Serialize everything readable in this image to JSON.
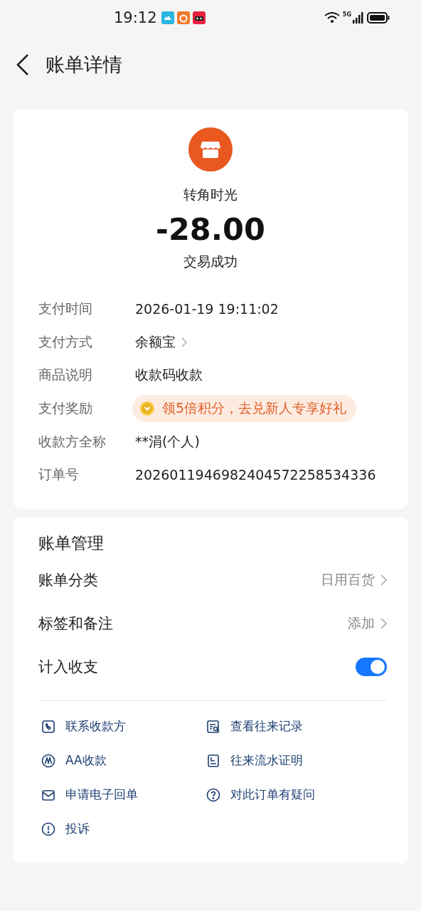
{
  "status_bar": {
    "time": "19:12",
    "network": "5G"
  },
  "header": {
    "title": "账单详情"
  },
  "summary": {
    "merchant": "转角时光",
    "amount": "-28.00",
    "status": "交易成功"
  },
  "details": [
    {
      "label": "支付时间",
      "value": "2026-01-19 19:11:02",
      "kind": "text"
    },
    {
      "label": "支付方式",
      "value": "余额宝",
      "kind": "link"
    },
    {
      "label": "商品说明",
      "value": "收款码收款",
      "kind": "text"
    },
    {
      "label": "支付奖励",
      "value": "领5倍积分，去兑新人专享好礼",
      "kind": "reward"
    },
    {
      "label": "收款方全称",
      "value": "**涓(个人)",
      "kind": "text"
    },
    {
      "label": "订单号",
      "value": "2026011946982404572258534336",
      "kind": "text"
    }
  ],
  "management": {
    "title": "账单管理",
    "rows": [
      {
        "label": "账单分类",
        "value": "日用百货",
        "kind": "link"
      },
      {
        "label": "标签和备注",
        "value": "添加",
        "kind": "link"
      },
      {
        "label": "计入收支",
        "kind": "toggle",
        "on": true
      }
    ],
    "actions": [
      {
        "label": "联系收款方"
      },
      {
        "label": "查看往来记录"
      },
      {
        "label": "AA收款"
      },
      {
        "label": "往来流水证明"
      },
      {
        "label": "申请电子回单"
      },
      {
        "label": "对此订单有疑问"
      },
      {
        "label": "投诉"
      }
    ]
  }
}
